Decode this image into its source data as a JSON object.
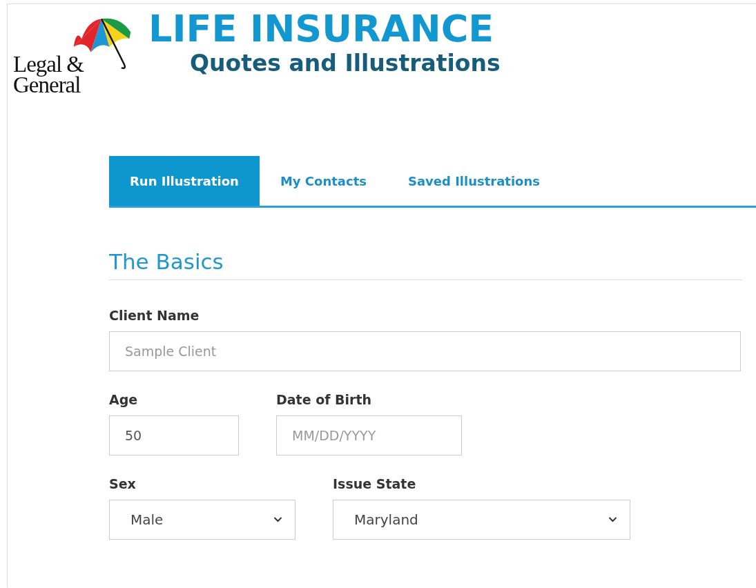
{
  "logo": {
    "line_1": "Legal &",
    "line_2": "General"
  },
  "header": {
    "title": "LIFE INSURANCE",
    "subtitle": "Quotes and Illustrations"
  },
  "tabs": [
    {
      "label": "Run Illustration",
      "selected": true
    },
    {
      "label": "My Contacts",
      "selected": false
    },
    {
      "label": "Saved Illustrations",
      "selected": false
    }
  ],
  "section": {
    "title": "The Basics"
  },
  "rows": [
    [
      {
        "kind": "text",
        "label": "Client Name",
        "placeholder": "Sample Client"
      }
    ],
    [
      {
        "kind": "text",
        "label": "Age",
        "value": "50"
      },
      {
        "kind": "text",
        "label": "Date of Birth",
        "placeholder": "MM/DD/YYYY"
      }
    ],
    [
      {
        "kind": "select",
        "label": "Sex",
        "value": "Male"
      },
      {
        "kind": "select",
        "label": "Issue State",
        "value": "Maryland"
      }
    ]
  ]
}
